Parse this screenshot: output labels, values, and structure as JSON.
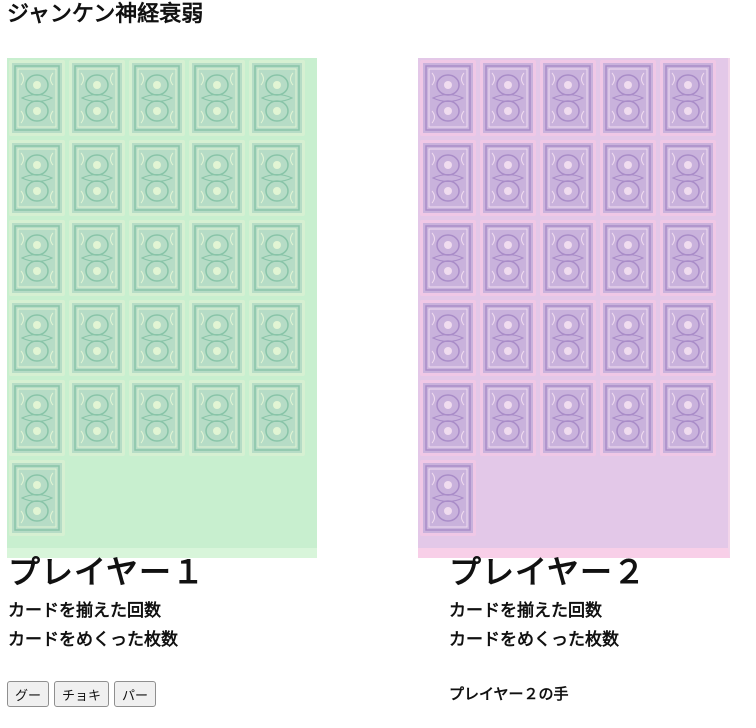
{
  "game": {
    "title": "ジャンケン神経衰弱"
  },
  "player1": {
    "name": "プレイヤー１",
    "pairs_label": "カードを揃えた回数",
    "flipped_label": "カードをめくった枚数",
    "card_count": 26,
    "card_color": "#b6dcc6",
    "board_color": "#c8efcf",
    "buttons": [
      {
        "id": "rock",
        "label": "グー"
      },
      {
        "id": "scissors",
        "label": "チョキ"
      },
      {
        "id": "paper",
        "label": "パー"
      }
    ]
  },
  "player2": {
    "name": "プレイヤー２",
    "pairs_label": "カードを揃えた回数",
    "flipped_label": "カードをめくった枚数",
    "hand_label": "プレイヤー２の手",
    "card_count": 26,
    "card_color": "#c9b2dc",
    "board_color": "#e3c8e8"
  }
}
